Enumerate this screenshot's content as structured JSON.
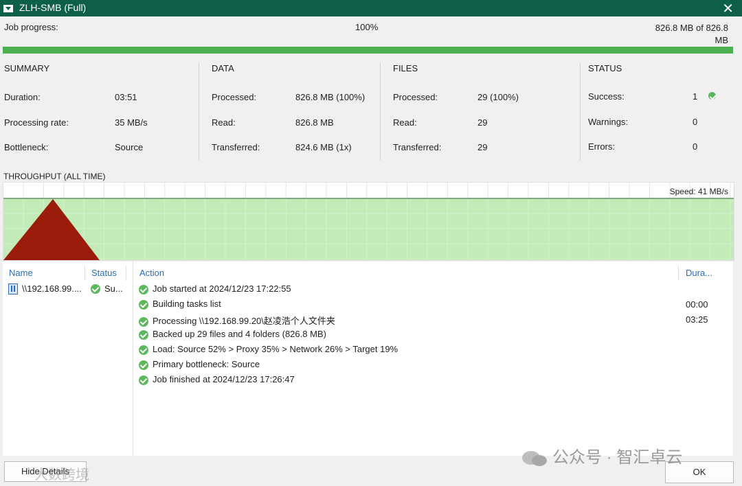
{
  "window": {
    "title": "ZLH-SMB (Full)",
    "close_glyph": "✕"
  },
  "progress": {
    "label": "Job progress:",
    "percent_text": "100%",
    "size_text": "826.8 MB of 826.8 MB",
    "fraction": 1.0,
    "color": "#4caf50"
  },
  "summary": {
    "heading": "SUMMARY",
    "rows": [
      {
        "label": "Duration:",
        "value": "03:51"
      },
      {
        "label": "Processing rate:",
        "value": "35 MB/s"
      },
      {
        "label": "Bottleneck:",
        "value": "Source"
      }
    ]
  },
  "data": {
    "heading": "DATA",
    "rows": [
      {
        "label": "Processed:",
        "value": "826.8 MB (100%)"
      },
      {
        "label": "Read:",
        "value": "826.8 MB"
      },
      {
        "label": "Transferred:",
        "value": "824.6 MB (1x)"
      }
    ]
  },
  "files": {
    "heading": "FILES",
    "rows": [
      {
        "label": "Processed:",
        "value": "29 (100%)"
      },
      {
        "label": "Read:",
        "value": "29"
      },
      {
        "label": "Transferred:",
        "value": "29"
      }
    ]
  },
  "status": {
    "heading": "STATUS",
    "rows": [
      {
        "label": "Success:",
        "value": "1"
      },
      {
        "label": "Warnings:",
        "value": "0"
      },
      {
        "label": "Errors:",
        "value": "0"
      }
    ]
  },
  "throughput": {
    "heading": "THROUGHPUT (ALL TIME)",
    "speed_text": "Speed: 41 MB/s",
    "area_color": "#c2ebb8",
    "peak_color": "#9b1c0b"
  },
  "objects": {
    "headers": {
      "name": "Name",
      "status": "Status"
    },
    "rows": [
      {
        "name": "\\\\192.168.99....",
        "status": "Su..."
      }
    ]
  },
  "log": {
    "headers": {
      "action": "Action",
      "duration": "Dura..."
    },
    "entries": [
      {
        "text": "Job started at 2024/12/23 17:22:55",
        "duration": ""
      },
      {
        "text": "Building tasks list",
        "duration": "00:00"
      },
      {
        "text": "Processing \\\\192.168.99.20\\赵凌浩个人文件夹",
        "duration": "03:25"
      },
      {
        "text": "Backed up 29 files and 4 folders (826.8 MB)",
        "duration": ""
      },
      {
        "text": "Load: Source 52% > Proxy 35% > Network 26% > Target 19%",
        "duration": ""
      },
      {
        "text": "Primary bottleneck: Source",
        "duration": ""
      },
      {
        "text": "Job finished at 2024/12/23 17:26:47",
        "duration": ""
      }
    ]
  },
  "footer": {
    "hide_details": "Hide Details",
    "ok": "OK"
  },
  "watermark": {
    "text": "公众号 · 智汇卓云",
    "overlay_text": "大数跨境"
  }
}
